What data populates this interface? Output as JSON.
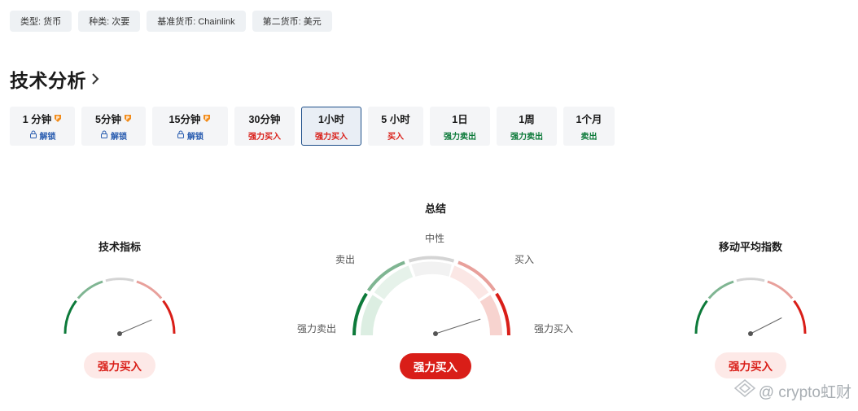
{
  "chips": [
    "类型: 货币",
    "种类: 次要",
    "基准货币: Chainlink",
    "第二货币: 美元"
  ],
  "section_title": "技术分析",
  "timeframes": [
    {
      "label": "1 分钟",
      "sub": "解锁",
      "locked": true
    },
    {
      "label": "5分钟",
      "sub": "解锁",
      "locked": true
    },
    {
      "label": "15分钟",
      "sub": "解锁",
      "locked": true
    },
    {
      "label": "30分钟",
      "sub": "强力买入",
      "locked": false
    },
    {
      "label": "1小时",
      "sub": "强力买入",
      "locked": false,
      "active": true
    },
    {
      "label": "5 小时",
      "sub": "买入",
      "locked": false
    },
    {
      "label": "1日",
      "sub": "强力卖出",
      "locked": false
    },
    {
      "label": "1周",
      "sub": "强力卖出",
      "locked": false
    },
    {
      "label": "1个月",
      "sub": "卖出",
      "locked": false
    }
  ],
  "gauges": {
    "left": {
      "title": "技术指标",
      "result": "强力买入",
      "needle_level": 0.87
    },
    "center": {
      "title": "总结",
      "result": "强力买入",
      "needle_level": 0.9,
      "labels": {
        "neutral": "中性",
        "sell": "卖出",
        "buy": "买入",
        "strong_sell": "强力卖出",
        "strong_buy": "强力买入"
      }
    },
    "right": {
      "title": "移动平均指数",
      "result": "强力买入",
      "needle_level": 0.85
    }
  },
  "watermark": "@ crypto虹财",
  "colors": {
    "strong_buy": "#d91e18",
    "strong_sell": "#0d7a3a",
    "neutral": "#d7d7d7",
    "active_border": "#1d4e89"
  }
}
